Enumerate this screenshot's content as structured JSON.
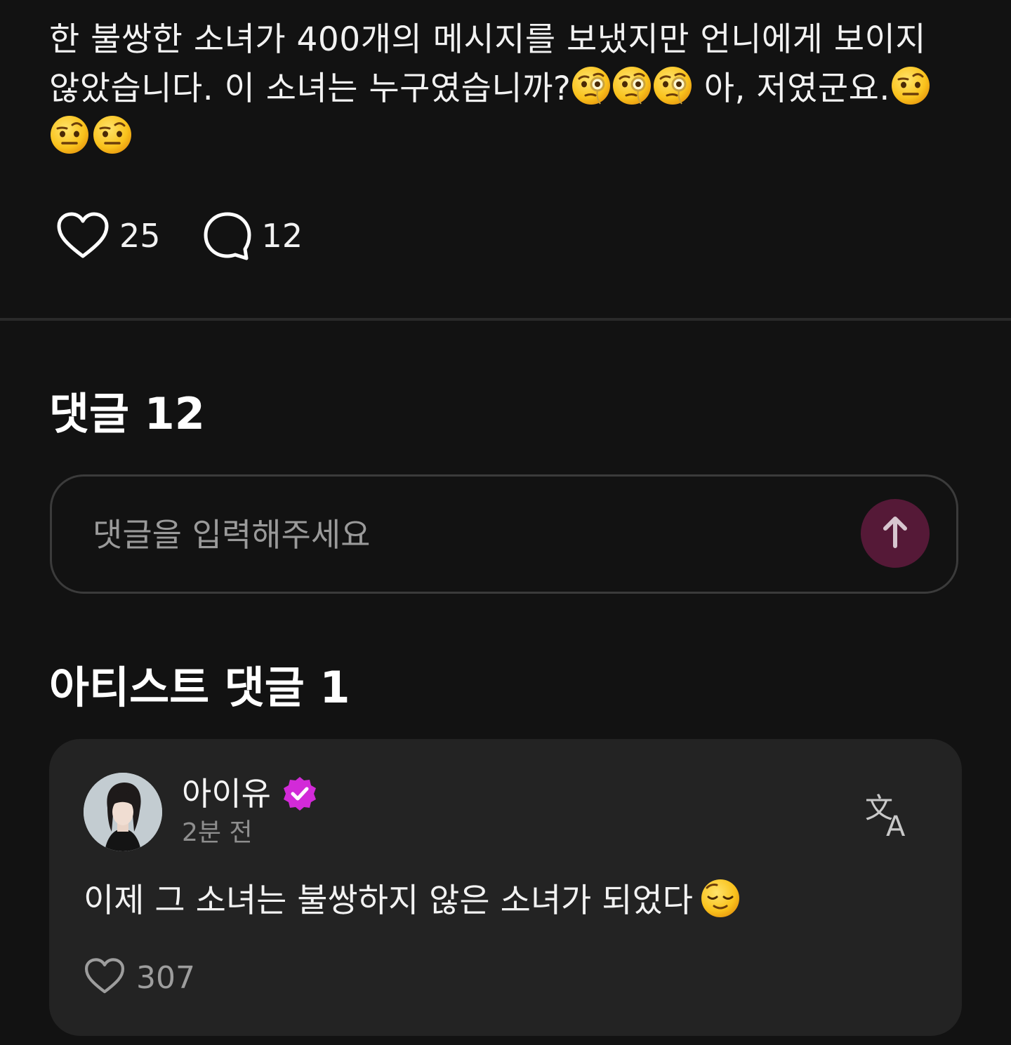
{
  "post": {
    "text_part1": "한 불쌍한 소녀가 400개의 메시지를 보냈지만 언니에게 보이지 않았습니다. 이 소녀는 누구였습니까?",
    "text_part2": " 아, 저였군요.",
    "emoji_monocle": "face-with-monocle",
    "emoji_raised_eyebrow": "face-with-raised-eyebrow",
    "likes": "25",
    "comments": "12"
  },
  "comments": {
    "title": "댓글 12",
    "input_placeholder": "댓글을 입력해주세요",
    "send_icon": "arrow-up-icon"
  },
  "artist_comments": {
    "title": "아티스트 댓글 1",
    "items": [
      {
        "author": "아이유",
        "verified": true,
        "time": "2분 전",
        "text": "이제 그 소녀는 불쌍하지 않은 소녀가 되었다",
        "emoji": "relieved-face",
        "likes": "307"
      }
    ]
  },
  "colors": {
    "background": "#121212",
    "card": "#232323",
    "send_button": "#551937",
    "verified_badge": "#d22ad8",
    "muted_text": "#8e8e8e"
  }
}
